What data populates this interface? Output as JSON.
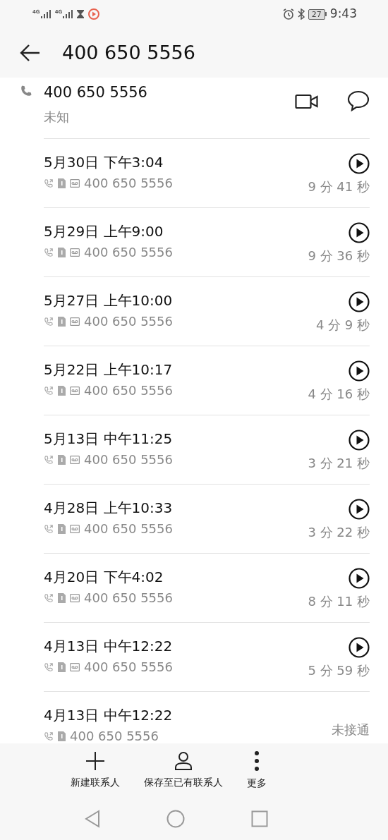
{
  "status_bar": {
    "networks": [
      "4G",
      "4G"
    ],
    "battery": "27",
    "time": "9:43"
  },
  "header": {
    "title": "400 650 5556"
  },
  "contact": {
    "number": "400 650 5556",
    "label": "未知"
  },
  "calls": [
    {
      "date": "5月30日 下午3:04",
      "number": "400 650 5556",
      "duration": "9 分 41 秒",
      "recorded": true
    },
    {
      "date": "5月29日 上午9:00",
      "number": "400 650 5556",
      "duration": "9 分 36 秒",
      "recorded": true
    },
    {
      "date": "5月27日 上午10:00",
      "number": "400 650 5556",
      "duration": "4 分 9 秒",
      "recorded": true
    },
    {
      "date": "5月22日 上午10:17",
      "number": "400 650 5556",
      "duration": "4 分 16 秒",
      "recorded": true
    },
    {
      "date": "5月13日 中午11:25",
      "number": "400 650 5556",
      "duration": "3 分 21 秒",
      "recorded": true
    },
    {
      "date": "4月28日 上午10:33",
      "number": "400 650 5556",
      "duration": "3 分 22 秒",
      "recorded": true
    },
    {
      "date": "4月20日 下午4:02",
      "number": "400 650 5556",
      "duration": "8 分 11 秒",
      "recorded": true
    },
    {
      "date": "4月13日 中午12:22",
      "number": "400 650 5556",
      "duration": "5 分 59 秒",
      "recorded": true
    },
    {
      "date": "4月13日 中午12:22",
      "number": "400 650 5556",
      "duration": "未接通",
      "recorded": false
    }
  ],
  "actions": [
    {
      "kind": "add",
      "label": "新建联系人"
    },
    {
      "kind": "person",
      "label": "保存至已有联系人"
    },
    {
      "kind": "more",
      "label": "更多"
    }
  ]
}
